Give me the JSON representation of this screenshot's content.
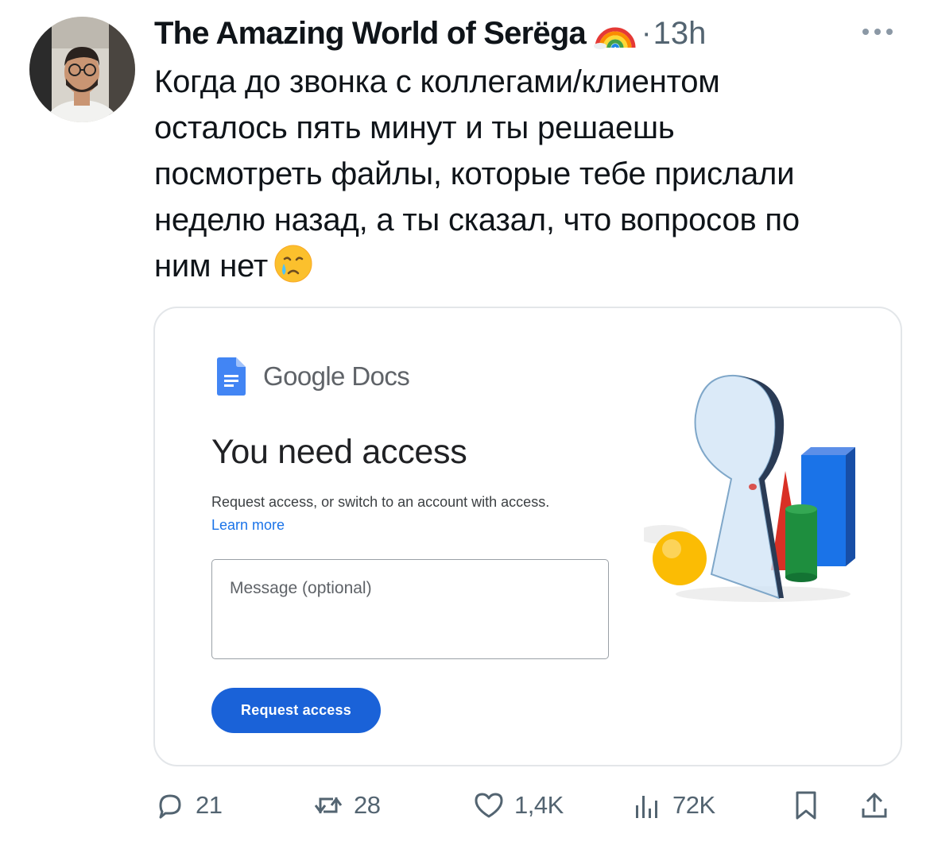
{
  "tweet": {
    "author_name": "The Amazing World of Serëga",
    "author_emoji": "rainbow-emoji",
    "separator": "·",
    "time_ago": "13h",
    "text_lines": [
      "Когда до звонка с коллегами/клиентом",
      "осталось пять минут и ты решаешь",
      "посмотреть файлы, которые тебе прислали",
      "неделю назад, а ты сказал, что вопросов по",
      "ним нет"
    ],
    "text_end_emoji": "crying-face-emoji"
  },
  "media": {
    "app_name_1": "Google",
    "app_name_2": "Docs",
    "title": "You need access",
    "description": "Request access, or switch to an account with access.",
    "learn_more": "Learn more",
    "message_placeholder": "Message (optional)",
    "request_button": "Request access",
    "brand_blue": "#1a62d8"
  },
  "actions": {
    "replies": "21",
    "reposts": "28",
    "likes": "1,4K",
    "views": "72K"
  },
  "colors": {
    "text": "#0f1419",
    "secondary": "#536471",
    "icon": "#536471"
  }
}
